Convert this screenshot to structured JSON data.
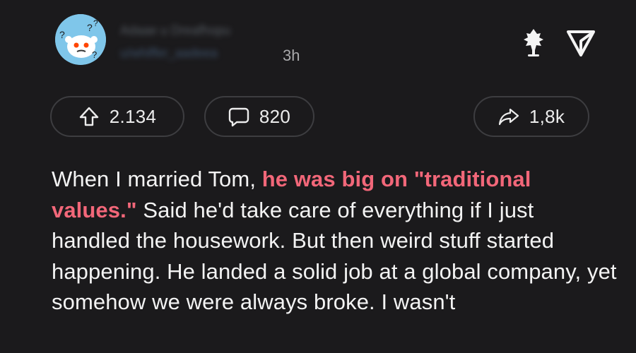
{
  "post": {
    "author_name": "Adaae u Dreafhopu",
    "author_handle": "u/whiffer_aadeea",
    "timestamp": "3h"
  },
  "actions": {
    "upvotes": "2.134",
    "comments": "820",
    "shares": "1,8k"
  },
  "icons": {
    "avatar": "reddit-snoo-confused-avatar",
    "award": "award-tree-icon",
    "share_top": "share-triangle-icon",
    "upvote": "upvote-arrow-icon",
    "comment": "comment-bubble-icon",
    "share": "share-arrow-icon"
  },
  "body": {
    "intro": "When I married Tom, ",
    "highlight": "he was big on \"traditional values.\"",
    "rest": " Said he'd take care of everything if I just handled the housework. But then weird stuff started happening. He landed a solid job at a global company, yet somehow we were always broke. I wasn't"
  },
  "colors": {
    "background": "#1b1a1c",
    "highlight": "#f26779",
    "avatar_bg": "#7fc6ea",
    "pill_border": "#3d3d40"
  }
}
